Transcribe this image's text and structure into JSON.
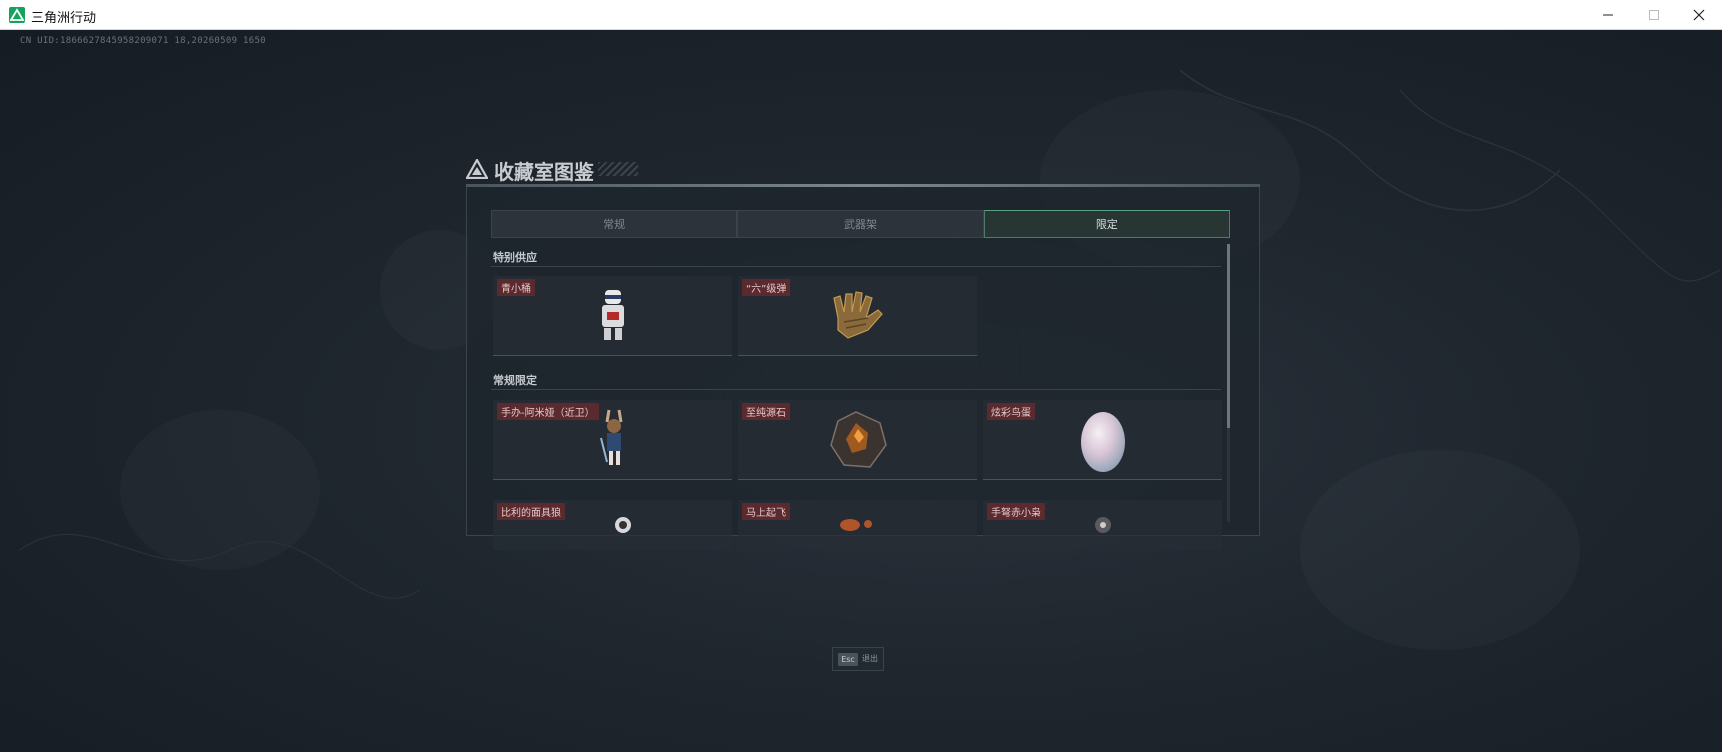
{
  "window": {
    "title": "三角洲行动",
    "icon": "delta-logo-icon",
    "controls": [
      "minimize-icon",
      "maximize-icon",
      "close-icon"
    ]
  },
  "uid_text": "CN UID:1866627845958209071 18,20260509 1650",
  "panel": {
    "title": "收藏室图鉴",
    "tabs": [
      {
        "label": "常规",
        "active": false
      },
      {
        "label": "武器架",
        "active": false
      },
      {
        "label": "限定",
        "active": true
      }
    ],
    "sections": [
      {
        "title": "特别供应",
        "items": [
          {
            "name": "青小桶",
            "icon": "robot-figurine-icon"
          },
          {
            "name": "“六”级弹",
            "icon": "gold-glove-icon"
          }
        ]
      },
      {
        "title": "常规限定",
        "items": [
          {
            "name": "手办-阿米娅（近卫）",
            "icon": "anime-figure-icon"
          },
          {
            "name": "至纯源石",
            "icon": "originium-crystal-icon"
          },
          {
            "name": "炫彩鸟蛋",
            "icon": "iridescent-egg-icon"
          },
          {
            "name": "比利的面具狼",
            "icon": "mask-wolf-icon"
          },
          {
            "name": "马上起飞",
            "icon": "rocket-icon"
          },
          {
            "name": "手弩赤小枭",
            "icon": "owl-crossbow-icon"
          }
        ]
      }
    ]
  },
  "esc_hint": {
    "key": "Esc",
    "label": "退出"
  },
  "colors": {
    "background": "#1b222b",
    "active_tab_border": "#57a086",
    "item_label_bg": "#5a2a2e",
    "app_icon": "#13a35c"
  }
}
